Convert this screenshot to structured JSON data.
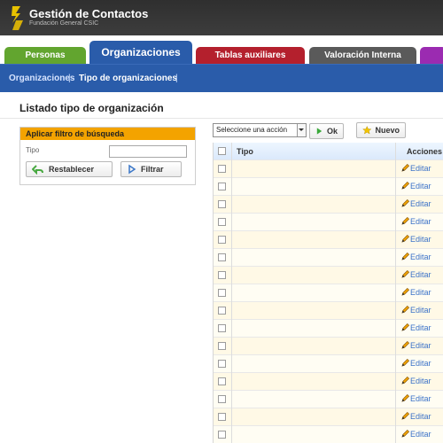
{
  "app": {
    "title": "Gestión de Contactos",
    "subtitle": "Fundación General CSIC"
  },
  "tabs": [
    {
      "label": "Personas",
      "color": "#62a52f"
    },
    {
      "label": "Organizaciones",
      "color": "#2a5caa",
      "active": true
    },
    {
      "label": "Tablas auxiliares",
      "color": "#b4202d"
    },
    {
      "label": "Valoración Interna",
      "color": "#5a5a5a"
    },
    {
      "label": "",
      "color": "#9b2bb1"
    }
  ],
  "subnav": {
    "item1": "Organizaciones",
    "separator": "|",
    "item2": "Tipo de organizaciones",
    "separator2": "|"
  },
  "page": {
    "title": "Listado tipo de organización"
  },
  "filter": {
    "heading": "Aplicar filtro de búsqueda",
    "field_label": "Tipo",
    "field_value": "",
    "reset_label": "Restablecer",
    "filter_label": "Filtrar"
  },
  "toolbar": {
    "action_select": "Seleccione una acción",
    "ok_label": "Ok",
    "new_label": "Nuevo"
  },
  "table": {
    "headers": [
      "Tipo",
      "Acciones"
    ],
    "rows": [
      {
        "tipo": "",
        "action": "Editar"
      },
      {
        "tipo": "",
        "action": "Editar"
      },
      {
        "tipo": "",
        "action": "Editar"
      },
      {
        "tipo": "",
        "action": "Editar"
      },
      {
        "tipo": "",
        "action": "Editar"
      },
      {
        "tipo": "",
        "action": "Editar"
      },
      {
        "tipo": "",
        "action": "Editar"
      },
      {
        "tipo": "",
        "action": "Editar"
      },
      {
        "tipo": "",
        "action": "Editar"
      },
      {
        "tipo": "",
        "action": "Editar"
      },
      {
        "tipo": "",
        "action": "Editar"
      },
      {
        "tipo": "",
        "action": "Editar"
      },
      {
        "tipo": "",
        "action": "Editar"
      },
      {
        "tipo": "",
        "action": "Editar"
      },
      {
        "tipo": "",
        "action": "Editar"
      },
      {
        "tipo": "",
        "action": "Editar"
      }
    ]
  }
}
